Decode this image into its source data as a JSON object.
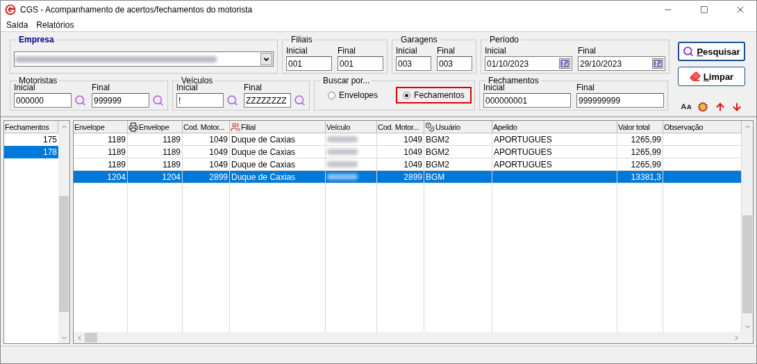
{
  "window": {
    "title": "CGS - Acompanhamento de acertos/fechamentos do motorista"
  },
  "menu": [
    "Saída",
    "Relatórios"
  ],
  "filter_rows": [
    [
      {
        "kind": "empresa",
        "title": "Empresa"
      },
      {
        "kind": "range",
        "title": "Filiais",
        "fields": [
          {
            "kind": "text",
            "label": "Inicial",
            "value": "001"
          },
          {
            "kind": "text",
            "label": "Final",
            "value": "001"
          }
        ]
      },
      {
        "kind": "range",
        "title": "Garagens",
        "fields": [
          {
            "kind": "text",
            "label": "Inicial",
            "value": "003"
          },
          {
            "kind": "text",
            "label": "Final",
            "value": "003"
          }
        ]
      },
      {
        "kind": "range",
        "title": "Período",
        "fields": [
          {
            "kind": "date",
            "label": "Inicial",
            "value": "01/10/2023"
          },
          {
            "kind": "date",
            "label": "Final",
            "value": "29/10/2023"
          }
        ]
      }
    ],
    [
      {
        "kind": "range",
        "title": "Motoristas",
        "fields": [
          {
            "kind": "lookup",
            "label": "Inicial",
            "value": "000000"
          },
          {
            "kind": "lookup",
            "label": "Final",
            "value": "999999"
          }
        ]
      },
      {
        "kind": "range",
        "title": "Veículos",
        "fields": [
          {
            "kind": "lookup",
            "label": "Inicial",
            "value": "!"
          },
          {
            "kind": "lookup",
            "label": "Final",
            "value": "ZZZZZZZZ"
          }
        ]
      },
      {
        "kind": "radio",
        "title": "Buscar por...",
        "options": [
          {
            "label": "Envelopes",
            "selected": false,
            "highlighted": false
          },
          {
            "label": "Fechamentos",
            "selected": true,
            "highlighted": true
          }
        ]
      },
      {
        "kind": "range",
        "title": "Fechamentos",
        "fields": [
          {
            "kind": "text",
            "label": "Inicial",
            "value": "000000001"
          },
          {
            "kind": "text",
            "label": "Final",
            "value": "999999999"
          }
        ]
      }
    ]
  ],
  "buttons": [
    {
      "label": "Pesquisar",
      "default": true
    },
    {
      "label": "Limpar",
      "default": false
    }
  ],
  "side_grid": {
    "column": "Fechamentos",
    "rows": [
      {
        "value": "175",
        "selected": false
      },
      {
        "value": "178",
        "selected": true
      }
    ]
  },
  "table": {
    "columns": [
      "Envelope",
      "Envelope",
      "Cod. Motor...",
      "Filial",
      "Veículo",
      "Cod. Motor...",
      "Usuário",
      "Apelido",
      "Valor total",
      "Observação"
    ],
    "rows": [
      {
        "selected": false,
        "cells": [
          "1189",
          "1189",
          "1049",
          "Duque de Caxias",
          {
            "kind": "blurred"
          },
          "1049",
          "BGM2",
          "APORTUGUES",
          "1265,99",
          null
        ]
      },
      {
        "selected": false,
        "cells": [
          "1189",
          "1189",
          "1049",
          "Duque de Caxias",
          {
            "kind": "blurred"
          },
          "1049",
          "BGM2",
          "APORTUGUES",
          "1265,99",
          null
        ]
      },
      {
        "selected": false,
        "cells": [
          "1189",
          "1189",
          "1049",
          "Duque de Caxias",
          {
            "kind": "blurred"
          },
          "1049",
          "BGM2",
          "APORTUGUES",
          "1265,99",
          null
        ]
      },
      {
        "selected": true,
        "cells": [
          "1204",
          "1204",
          "2899",
          "Duque de Caxias",
          {
            "kind": "blurred"
          },
          "2899",
          "BGM",
          null,
          "13381,3",
          null
        ]
      }
    ]
  }
}
